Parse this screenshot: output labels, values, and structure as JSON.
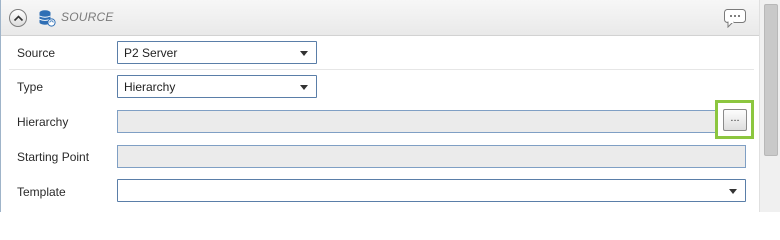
{
  "section": {
    "title": "SOURCE",
    "collapse_icon": "chevron-up-icon",
    "section_icon": "database-sync-icon",
    "comment_icon": "comment-icon",
    "colors": {
      "accent": "#8cc63f",
      "border": "#5a7ea8"
    }
  },
  "fields": {
    "source": {
      "label": "Source",
      "value": "P2 Server"
    },
    "type": {
      "label": "Type",
      "value": "Hierarchy"
    },
    "hierarchy": {
      "label": "Hierarchy",
      "value": "",
      "browse_label": "..."
    },
    "starting_point": {
      "label": "Starting Point",
      "value": ""
    },
    "template": {
      "label": "Template",
      "value": ""
    }
  }
}
